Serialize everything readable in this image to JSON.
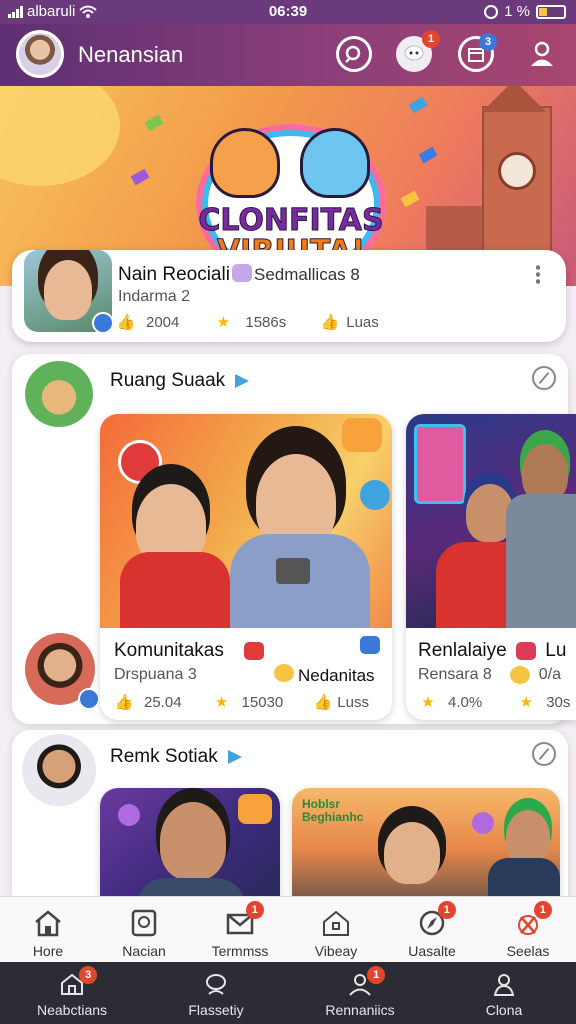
{
  "status_bar": {
    "carrier": "albaruli",
    "time": "06:39",
    "battery_text": "1 %"
  },
  "header": {
    "title": "Nenansian",
    "icons": [
      "search-icon",
      "chat-icon",
      "notification-box-icon",
      "profile-icon"
    ],
    "chat_badge": "1",
    "box_badge": "3"
  },
  "hero": {
    "logo_line1": "CLONFITAS",
    "logo_line2": "VIRIUTA!"
  },
  "featured": {
    "name": "Nain Reociali",
    "tag": "Sedmallicas 8",
    "subtitle": "Indarma 2",
    "likes": "2004",
    "stars": "1586s",
    "extra": "Luas"
  },
  "section1": {
    "title": "Ruang Suaak",
    "cards": [
      {
        "name": "Komunitakas",
        "subtitle": "Drspuana 3",
        "tag": "Nedanitas",
        "likes": "25.04",
        "stars": "15030",
        "extra": "Luss"
      },
      {
        "name": "Renlalaiye",
        "tag": "Lu",
        "subtitle": "Rensara 8",
        "tag2": "0/a",
        "stars": "4.0%",
        "extra": "30s"
      }
    ]
  },
  "section2": {
    "title": "Remk Sotiak",
    "banner_text1": "Hoblsr",
    "banner_text2": "Beghianhc"
  },
  "tabs": [
    {
      "label": "Hore",
      "icon": "home-icon",
      "badge": ""
    },
    {
      "label": "Nacian",
      "icon": "clock-icon",
      "badge": ""
    },
    {
      "label": "Termmss",
      "icon": "mail-icon",
      "badge": "1"
    },
    {
      "label": "Vibeay",
      "icon": "house-icon",
      "badge": ""
    },
    {
      "label": "Uasalte",
      "icon": "compass-icon",
      "badge": "1"
    },
    {
      "label": "Seelas",
      "icon": "tools-icon",
      "badge": "1"
    }
  ],
  "nav": [
    {
      "label": "Neabctians",
      "icon": "home-icon",
      "badge": "3"
    },
    {
      "label": "Flassetiy",
      "icon": "chat-bubble-icon",
      "badge": ""
    },
    {
      "label": "Rennaniics",
      "icon": "person-icon",
      "badge": "1"
    },
    {
      "label": "Clona",
      "icon": "user-icon",
      "badge": ""
    }
  ],
  "colors": {
    "brand": "#6a3a7c",
    "accent": "#e2462d",
    "star": "#f5b800"
  }
}
